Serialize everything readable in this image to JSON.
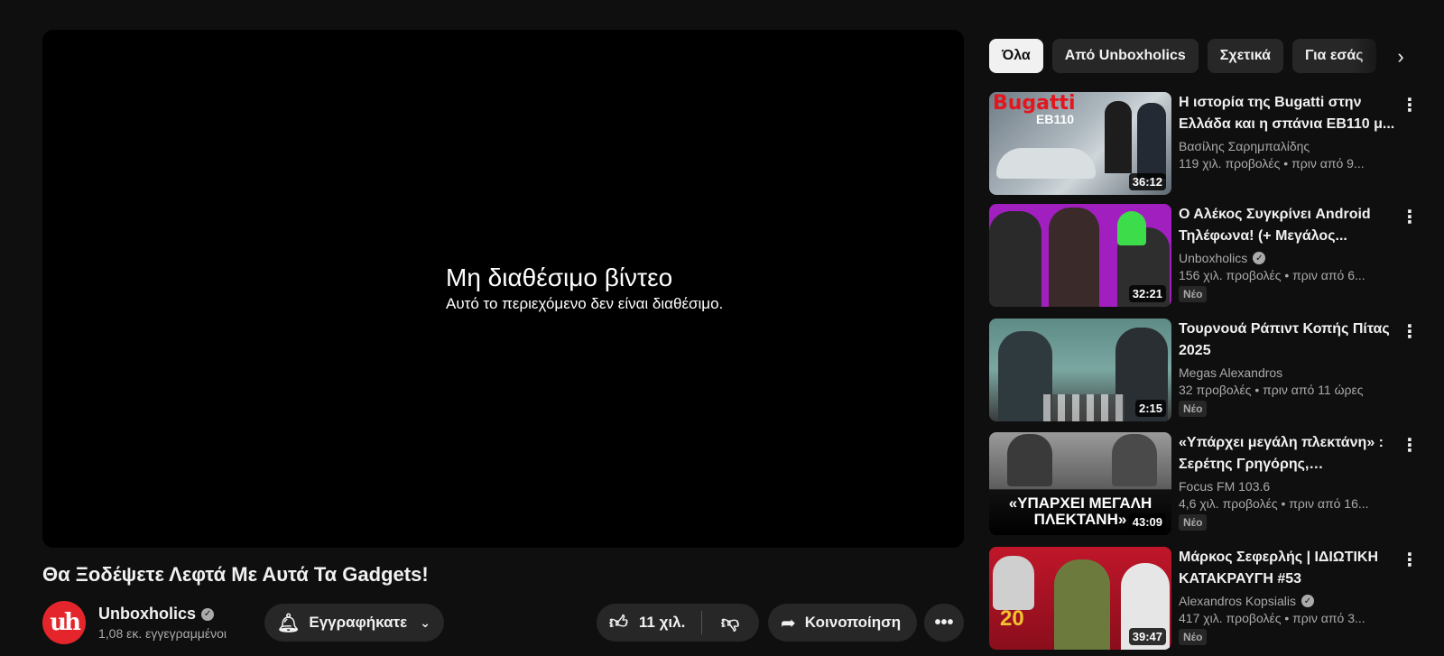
{
  "player": {
    "title": "Μη διαθέσιμο βίντεο",
    "subtitle": "Αυτό το περιεχόμενο δεν είναι διαθέσιμο."
  },
  "video": {
    "title": "Θα Ξοδέψετε Λεφτά Με Αυτά Τα Gadgets!",
    "channel": "Unboxholics",
    "subscribers": "1,08 εκ. εγγεγραμμένοι",
    "subscribe_label": "Εγγραφήκατε",
    "likes": "11 χιλ.",
    "share_label": "Κοινοποίηση"
  },
  "chips": [
    {
      "label": "Όλα",
      "active": true
    },
    {
      "label": "Από Unboxholics",
      "active": false
    },
    {
      "label": "Σχετικά",
      "active": false
    },
    {
      "label": "Για εσάς",
      "active": false
    }
  ],
  "recommendations": [
    {
      "title": "Η ιστορία της Bugatti στην Ελλάδα και η σπάνια EB110 μ...",
      "channel": "Βασίλης Σαρημπαλίδης",
      "verified": false,
      "meta": "119 χιλ. προβολές • πριν από 9...",
      "duration": "36:12",
      "new": "",
      "thumb_text_1": "Bugatti",
      "thumb_text_2": "EB110"
    },
    {
      "title": "Ο Αλέκος Συγκρίνει Android Τηλέφωνα! (+ Μεγάλος...",
      "channel": "Unboxholics",
      "verified": true,
      "meta": "156 χιλ. προβολές • πριν από 6...",
      "duration": "32:21",
      "new": "Νέο"
    },
    {
      "title": "Τουρνουά Ράπιντ Κοπής Πίτας 2025",
      "channel": "Megas Alexandros",
      "verified": false,
      "meta": "32 προβολές • πριν από 11 ώρες",
      "duration": "2:15",
      "new": "Νέο"
    },
    {
      "title": "«Υπάρχει μεγάλη πλεκτάνη» : Σερέτης Γρηγόρης, Απόστολο...",
      "channel": "Focus FM 103.6",
      "verified": false,
      "meta": "4,6 χιλ. προβολές • πριν από 16...",
      "duration": "43:09",
      "new": "Νέο",
      "thumb_text_1": "«ΥΠΑΡΧΕΙ ΜΕΓΑΛΗ",
      "thumb_text_2": "ΠΛΕΚΤΑΝΗ»"
    },
    {
      "title": "Μάρκος Σεφερλής | ΙΔΙΩΤΙΚΗ ΚΑΤΑΚΡΑΥΓΗ #53",
      "channel": "Alexandros Kopsialis",
      "verified": true,
      "meta": "417 χιλ. προβολές • πριν από 3...",
      "duration": "39:47",
      "new": "Νέο",
      "thumb_text_1": "20"
    }
  ],
  "icons": {
    "bell": "bell-icon",
    "chevron": "chevron-down-icon",
    "like": "thumbs-up-icon",
    "dislike": "thumbs-down-icon",
    "share": "share-icon",
    "more": "more-horizontal-icon",
    "kebab": "more-vertical-icon",
    "next": "chevron-right-icon"
  }
}
